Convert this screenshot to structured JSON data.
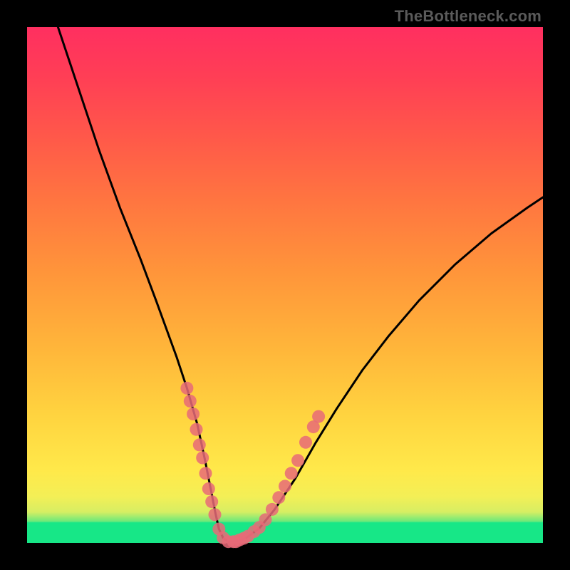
{
  "watermark": "TheBottleneck.com",
  "colors": {
    "marker": "#e86a78",
    "curve": "#000000",
    "teal": "#17e787"
  },
  "chart_data": {
    "type": "line",
    "title": "",
    "xlabel": "",
    "ylabel": "",
    "xlim": [
      0,
      100
    ],
    "ylim": [
      0,
      100
    ],
    "series": [
      {
        "name": "bottleneck-curve",
        "x": [
          6,
          10,
          14,
          18,
          22,
          25,
          27,
          29,
          31,
          33,
          34.5,
          35.6,
          36.5,
          37.2,
          38,
          39,
          40.5,
          42.5,
          45,
          48,
          52,
          56,
          60,
          65,
          70,
          76,
          83,
          90,
          97,
          100
        ],
        "y": [
          100,
          88,
          76,
          65,
          55,
          47,
          41.5,
          36,
          30,
          23,
          16,
          10.5,
          5.8,
          2.7,
          1.0,
          0.25,
          0.25,
          1.0,
          2.8,
          6.5,
          12.5,
          19.5,
          26,
          33.5,
          40,
          47,
          54,
          60,
          65,
          67
        ]
      }
    ],
    "valley_floor": {
      "x_start": 39,
      "x_end": 40.5,
      "y": 0.25
    },
    "markers": {
      "note": "dense scatter clusters along the curve near the valley walls and floor",
      "left_wall": [
        [
          31,
          30
        ],
        [
          31.6,
          27.5
        ],
        [
          32.2,
          25
        ],
        [
          32.8,
          22
        ],
        [
          33.4,
          19
        ],
        [
          34,
          16.5
        ],
        [
          34.6,
          13.5
        ],
        [
          35.2,
          10.5
        ],
        [
          35.8,
          8
        ],
        [
          36.4,
          5.5
        ]
      ],
      "floor": [
        [
          37.2,
          2.7
        ],
        [
          38,
          1.0
        ],
        [
          39,
          0.25
        ],
        [
          40,
          0.25
        ],
        [
          40.5,
          0.25
        ],
        [
          41.2,
          0.6
        ],
        [
          42,
          0.9
        ],
        [
          42.8,
          1.3
        ]
      ],
      "right_wall": [
        [
          44,
          2.2
        ],
        [
          45,
          3.0
        ],
        [
          46.2,
          4.5
        ],
        [
          47.5,
          6.5
        ],
        [
          48.8,
          8.8
        ],
        [
          50,
          11
        ],
        [
          51.2,
          13.5
        ],
        [
          52.5,
          16
        ],
        [
          54,
          19.5
        ],
        [
          55.5,
          22.5
        ],
        [
          56.5,
          24.5
        ]
      ]
    }
  }
}
